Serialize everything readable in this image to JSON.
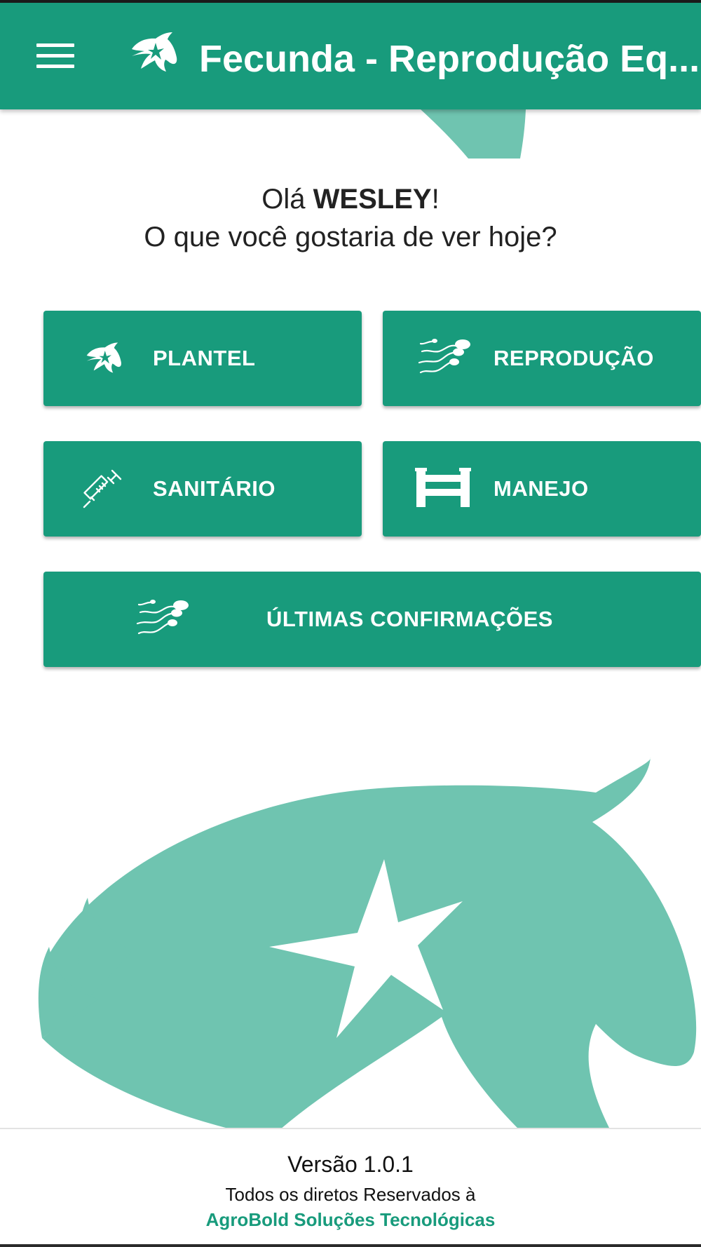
{
  "app_bar": {
    "title": "Fecunda - Reprodução Eq...",
    "menu_icon": "hamburger-menu-icon",
    "logo_icon": "horse-head-logo-icon"
  },
  "greeting": {
    "hello": "Olá ",
    "user_name": "WESLEY",
    "exclamation": "!",
    "question": "O que você gostaria de ver hoje?"
  },
  "menu": {
    "plantel": {
      "label": "PLANTEL",
      "icon": "horse-head-icon"
    },
    "reproducao": {
      "label": "REPRODUÇÃO",
      "icon": "sperm-icon"
    },
    "sanitario": {
      "label": "SANITÁRIO",
      "icon": "syringe-icon"
    },
    "manejo": {
      "label": "MANEJO",
      "icon": "fence-icon"
    },
    "ultimas": {
      "label": "ÚLTIMAS CONFIRMAÇÕES",
      "icon": "sperm-icon"
    }
  },
  "footer": {
    "version": "Versão 1.0.1",
    "rights": "Todos os diretos Reservados à",
    "company": "AgroBold Soluções Tecnológicas"
  },
  "colors": {
    "primary": "#189b7c",
    "watermark": "#6fc4b0",
    "text_dark": "#222222",
    "white": "#ffffff"
  }
}
